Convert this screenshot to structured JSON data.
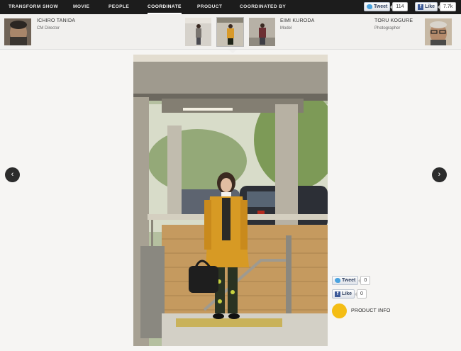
{
  "nav": {
    "items": [
      "TRANSFORM SHOW",
      "MOVIE",
      "PEOPLE",
      "COORDINATE",
      "PRODUCT",
      "COORDINATED BY"
    ],
    "active": "COORDINATE"
  },
  "share_top": {
    "tweet_label": "Tweet",
    "tweet_count": "114",
    "like_label": "Like",
    "like_count": "7.7k"
  },
  "people": {
    "left": {
      "name": "ICHIRO TANIDA",
      "role": "CM Director"
    },
    "center": {
      "name": "EIMI KURODA",
      "role": "Model"
    },
    "right": {
      "name": "TORU KOGURE",
      "role": "Photographer"
    }
  },
  "thumbnails": [
    "coordinate-1",
    "coordinate-2",
    "coordinate-3"
  ],
  "share_side": {
    "tweet_label": "Tweet",
    "tweet_count": "0",
    "like_label": "Like",
    "like_count": "0"
  },
  "product": {
    "dot_label": "",
    "label": "PRODUCT INFO"
  },
  "colors": {
    "nav_bg": "#1c1c1c",
    "page_bg": "#f6f5f3",
    "product_dot": "#f4bd14",
    "arrow_bg": "#2c2c2c"
  }
}
